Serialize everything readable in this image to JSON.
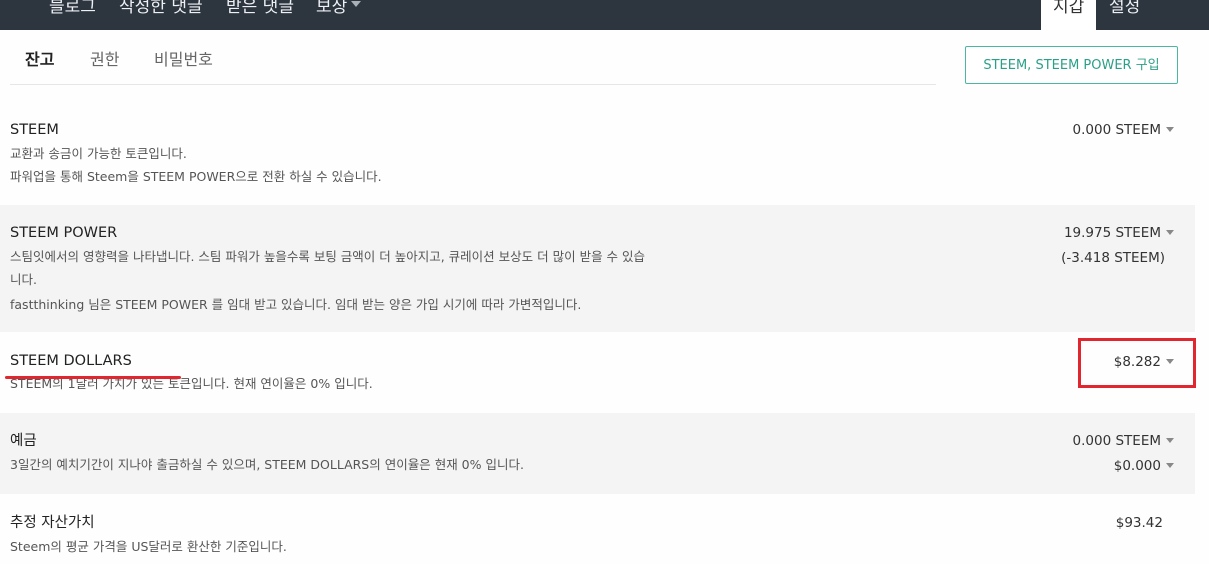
{
  "nav": {
    "items": [
      "블로그",
      "작성한 댓글",
      "받은 댓글",
      "보상"
    ],
    "active": "지갑",
    "settings": "설정"
  },
  "tabs": [
    "잔고",
    "권한",
    "비밀번호"
  ],
  "buy_button": "STEEM, STEEM POWER 구입",
  "rows": {
    "steem": {
      "title": "STEEM",
      "desc1": "교환과 송금이 가능한 토큰입니다.",
      "desc2": "파워업을 통해 Steem을 STEEM POWER으로 전환 하실 수 있습니다.",
      "amount": "0.000 STEEM"
    },
    "steem_power": {
      "title": "STEEM POWER",
      "desc1": "스팀잇에서의 영향력을 나타냅니다. 스팀 파워가 높을수록 보팅 금액이 더 높아지고, 큐레이션 보상도 더 많이 받을 수 있습",
      "desc1b": "니다.",
      "desc2": "fastthinking 님은 STEEM POWER 를 임대 받고 있습니다. 임대 받는 양은 가입 시기에 따라 가변적입니다.",
      "amount": "19.975 STEEM",
      "delegated": "(-3.418 STEEM)"
    },
    "steem_dollars": {
      "title": "STEEM DOLLARS",
      "desc1": "STEEM의 1달러 가치가 있는 토큰입니다. 현재 연이율은 0% 입니다.",
      "amount": "$8.282"
    },
    "savings": {
      "title": "예금",
      "desc1": "3일간의 예치기간이 지나야 출금하실 수 있으며, STEEM DOLLARS의 연이율은 현재 0% 입니다.",
      "amount_steem": "0.000 STEEM",
      "amount_sbd": "$0.000"
    },
    "estimated": {
      "title": "추정 자산가치",
      "desc1": "Steem의 평균 가격을 US달러로 환산한 기준입니다.",
      "amount": "$93.42"
    }
  },
  "colors": {
    "topbar": "#2d353f",
    "accent": "#4ab7a2",
    "highlight": "#e2262f"
  }
}
